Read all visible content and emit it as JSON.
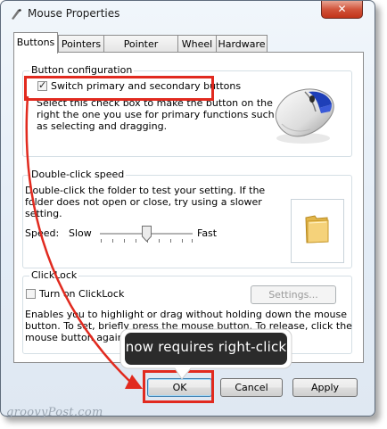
{
  "window": {
    "title": "Mouse Properties",
    "close_label": "✕"
  },
  "tabs": [
    {
      "label": "Buttons",
      "active": true
    },
    {
      "label": "Pointers",
      "active": false
    },
    {
      "label": "Pointer Options",
      "active": false
    },
    {
      "label": "Wheel",
      "active": false
    },
    {
      "label": "Hardware",
      "active": false
    }
  ],
  "button_config": {
    "group_title": "Button configuration",
    "checkbox_label": "Switch primary and secondary buttons",
    "checked": true,
    "description_lines": [
      "Select this check box to make the button on the",
      "right the one you use for primary functions such",
      "as selecting and dragging."
    ]
  },
  "double_click": {
    "group_title": "Double-click speed",
    "description_lines": [
      "Double-click the folder to test your setting. If the",
      "folder does not open or close, try using a slower",
      "setting."
    ],
    "speed_label": "Speed:",
    "slow_label": "Slow",
    "fast_label": "Fast",
    "slider_position_fraction": 0.5
  },
  "clicklock": {
    "group_title": "ClickLock",
    "checkbox_label": "Turn on ClickLock",
    "checked": false,
    "settings_button_label": "Settings...",
    "description_lines": [
      "Enables you to highlight or drag without holding down the mouse",
      "button. To set, briefly press the mouse button. To release, click the",
      "mouse button again."
    ]
  },
  "footer": {
    "ok_label": "OK",
    "cancel_label": "Cancel",
    "apply_label": "Apply"
  },
  "annotation": {
    "callout_text": "now requires right-click",
    "highlight_color": "#e12a1f"
  },
  "watermark": "groovyPost.com"
}
